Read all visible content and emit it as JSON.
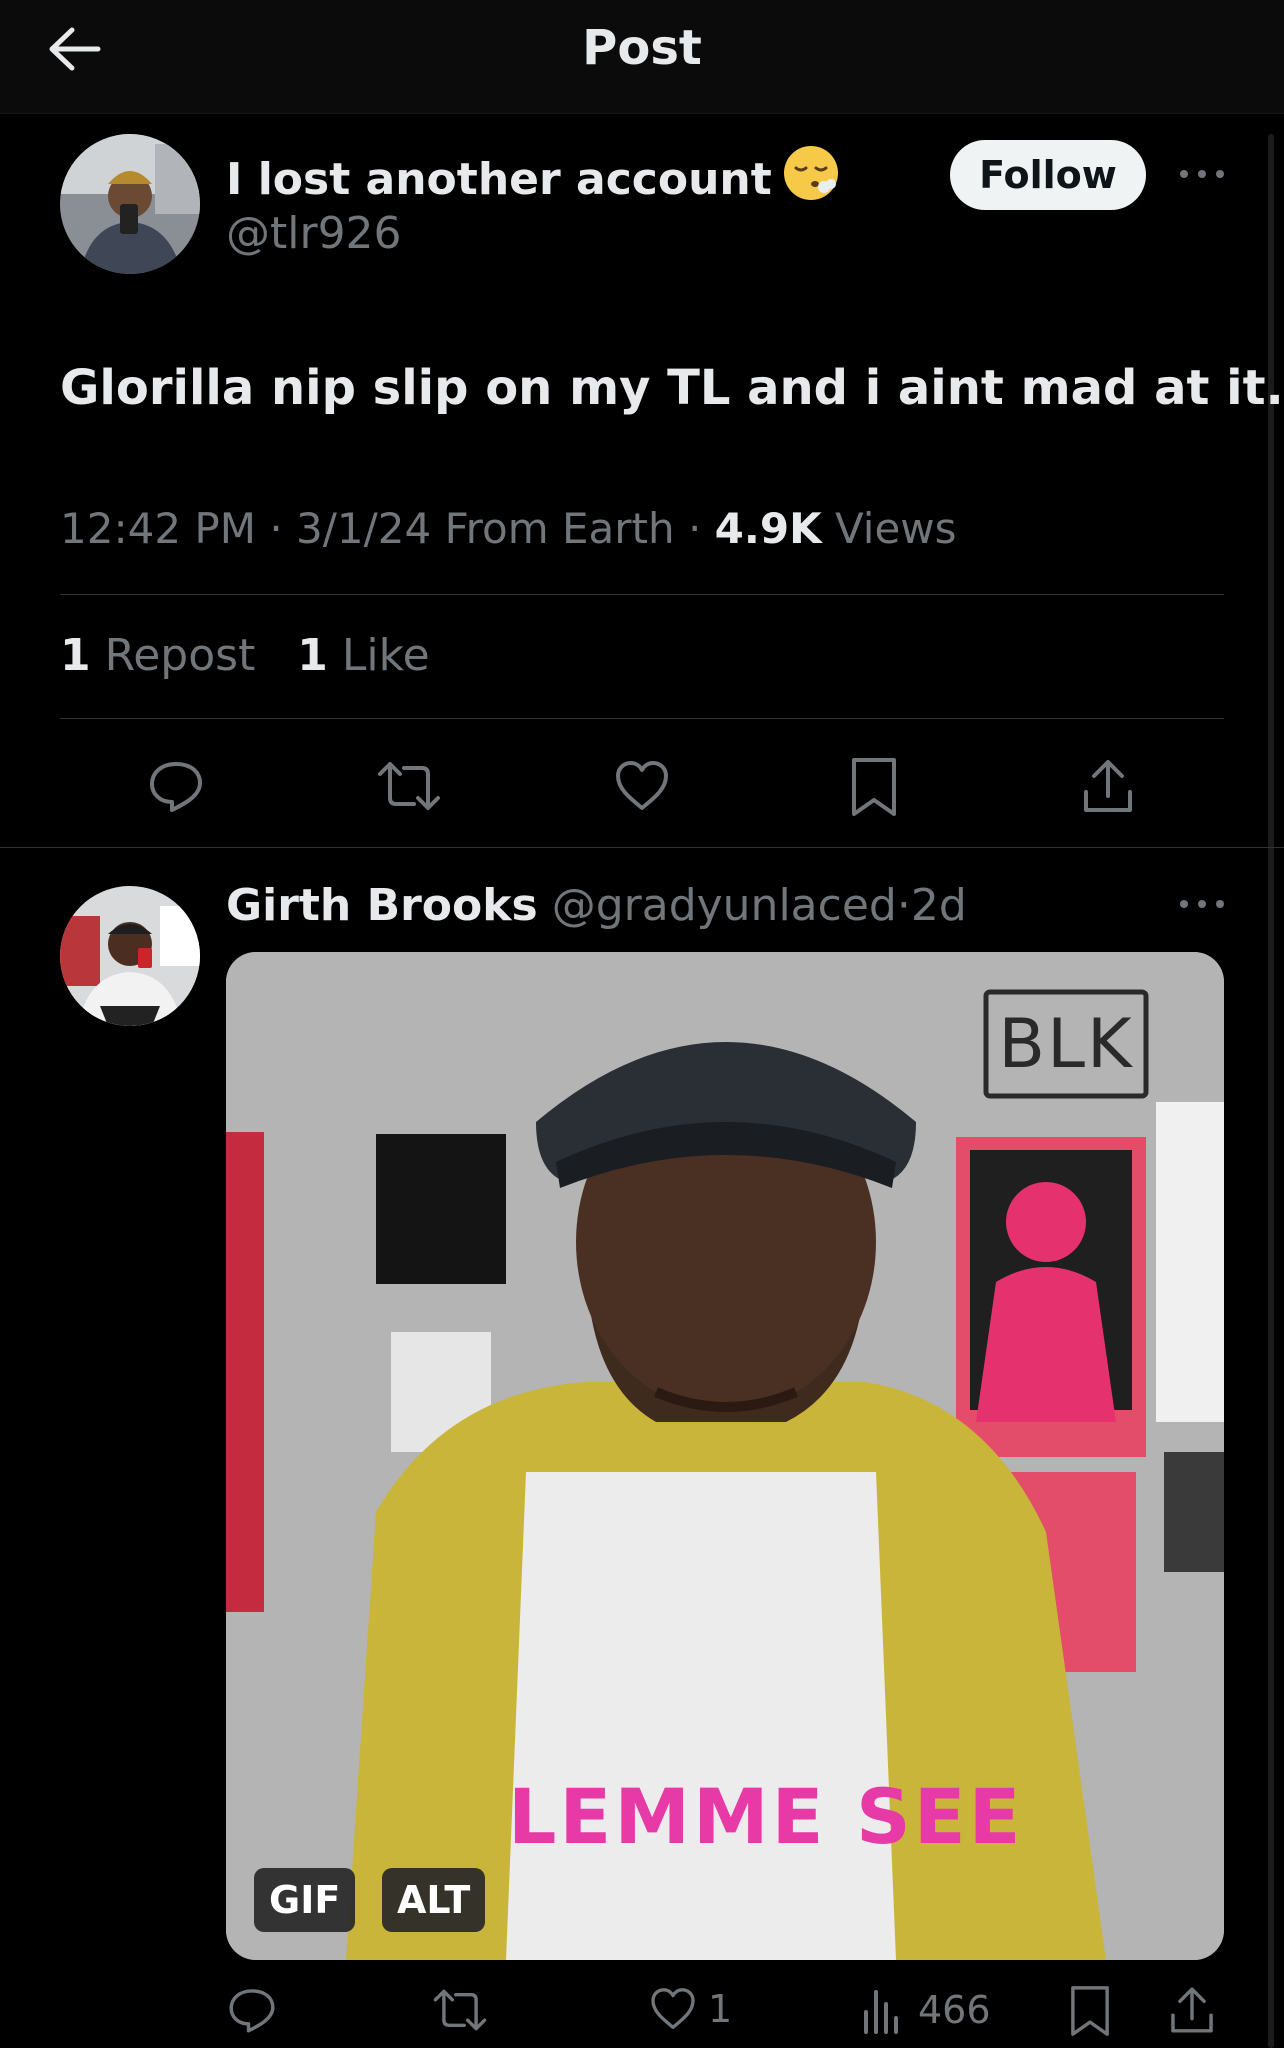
{
  "header": {
    "title": "Post"
  },
  "main_post": {
    "display_name": "I lost another account",
    "handle": "@tlr926",
    "follow_label": "Follow",
    "text": "Glorilla nip slip on my TL and i aint mad at it.",
    "time": "12:42 PM",
    "date": "3/1/24",
    "source": "From Earth",
    "views_count": "4.9K",
    "views_label": "Views",
    "reposts_count": "1",
    "reposts_label": "Repost",
    "likes_count": "1",
    "likes_label": "Like",
    "actions": [
      "reply-icon",
      "repost-icon",
      "like-icon",
      "bookmark-icon",
      "share-icon"
    ]
  },
  "reply": {
    "display_name": "Girth Brooks",
    "handle": "@gradyunlaced",
    "separator": "·",
    "age": "2d",
    "media": {
      "watermark": "BLK",
      "caption": "LEMME SEE",
      "gif_badge": "GIF",
      "alt_badge": "ALT"
    },
    "like_count": "1",
    "view_count": "466"
  }
}
